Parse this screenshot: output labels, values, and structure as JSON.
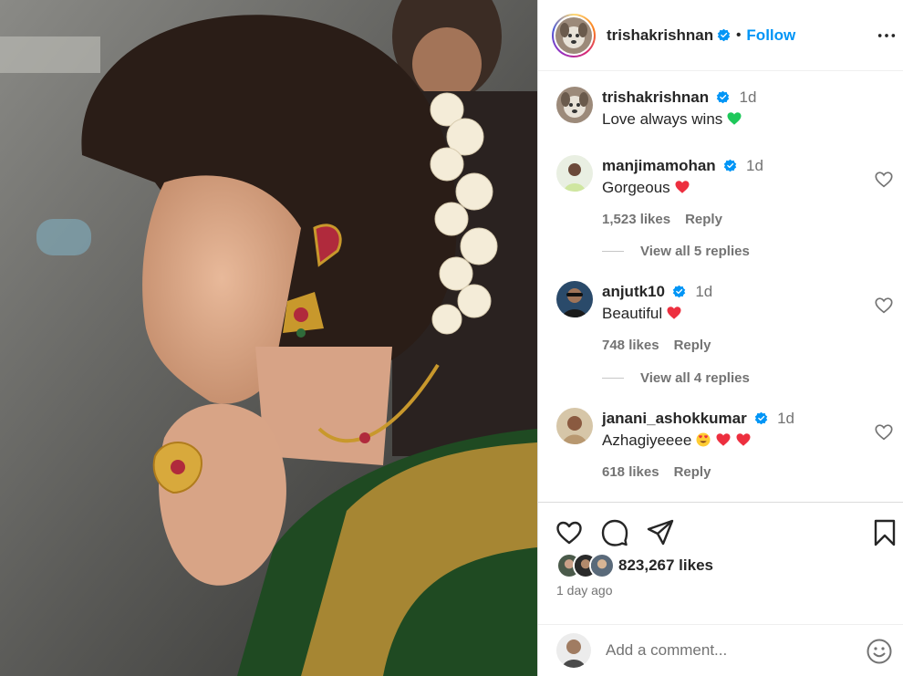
{
  "post": {
    "author": "trishakrishnan",
    "follow_label": "Follow",
    "separator": "•",
    "likes": "823,267 likes",
    "date": "1 day ago"
  },
  "caption": {
    "user": "trishakrishnan",
    "time": "1d",
    "text": "Love always wins",
    "emoji": "green-heart"
  },
  "comments": [
    {
      "user": "manjimamohan",
      "time": "1d",
      "text": "Gorgeous",
      "likes": "1,523 likes",
      "reply_label": "Reply",
      "view_replies": "View all 5 replies",
      "emoji": [
        "red-heart"
      ]
    },
    {
      "user": "anjutk10",
      "time": "1d",
      "text": "Beautiful",
      "likes": "748 likes",
      "reply_label": "Reply",
      "view_replies": "View all 4 replies",
      "emoji": [
        "red-heart"
      ]
    },
    {
      "user": "janani_ashokkumar",
      "time": "1d",
      "text": "Azhagiyeeee",
      "likes": "618 likes",
      "reply_label": "Reply",
      "emoji": [
        "heart-eyes",
        "red-heart",
        "red-heart"
      ]
    }
  ],
  "composer": {
    "placeholder": "Add a comment..."
  },
  "icons": {
    "verified": "verified-badge-icon",
    "more": "more-options-icon",
    "like": "heart-icon",
    "comment": "comment-icon",
    "share": "share-icon",
    "save": "bookmark-icon",
    "emoji": "emoji-icon"
  },
  "colors": {
    "accent": "#0095f6",
    "heart": "#ed4956",
    "verified": "#0095f6",
    "muted": "#737373"
  }
}
